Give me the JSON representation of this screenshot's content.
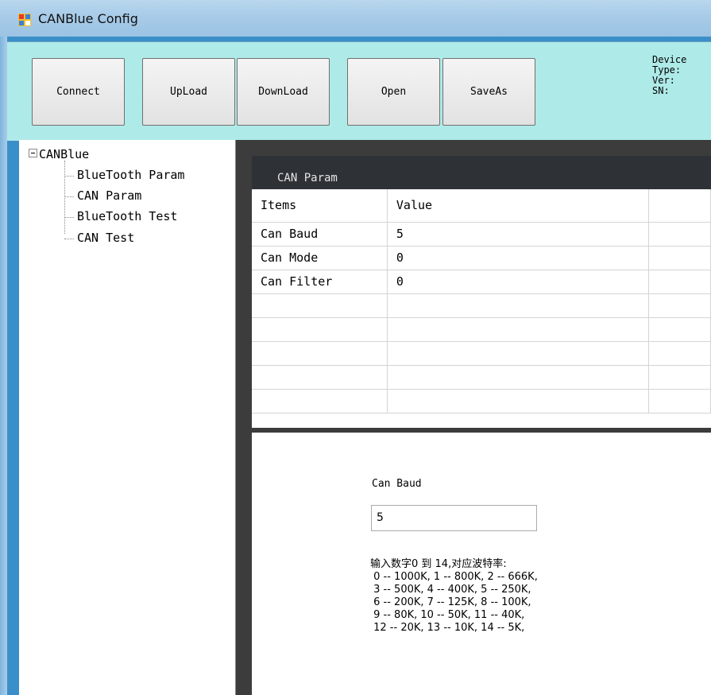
{
  "window": {
    "title": "CANBlue Config"
  },
  "toolbar": {
    "connect": "Connect",
    "upload": "UpLoad",
    "download": "DownLoad",
    "open": "Open",
    "saveas": "SaveAs",
    "device_info": "Device\nType:\nVer:\nSN:"
  },
  "tree": {
    "root": "CANBlue",
    "items": [
      "BlueTooth Param",
      "CAN Param",
      "BlueTooth Test",
      "CAN Test"
    ]
  },
  "panel": {
    "title": "CAN Param",
    "columns": [
      "Items",
      "Value"
    ],
    "rows": [
      {
        "item": "Can Baud",
        "value": "5"
      },
      {
        "item": "Can Mode",
        "value": "0"
      },
      {
        "item": "Can Filter",
        "value": "0"
      }
    ]
  },
  "detail": {
    "label": "Can Baud",
    "input_value": "5",
    "help": "输入数字0 到 14,对应波特率:\n 0 -- 1000K, 1 -- 800K, 2 -- 666K,\n 3 -- 500K, 4 -- 400K, 5 -- 250K,\n 6 -- 200K, 7 -- 125K, 8 -- 100K,\n 9 -- 80K, 10 -- 50K, 11 -- 40K,\n 12 -- 20K, 13 -- 10K, 14 -- 5K,"
  },
  "colors": {
    "toolbar_bg": "#aeeae8",
    "dark_bg": "#3c3c3c",
    "header_bg": "#2e3236"
  }
}
